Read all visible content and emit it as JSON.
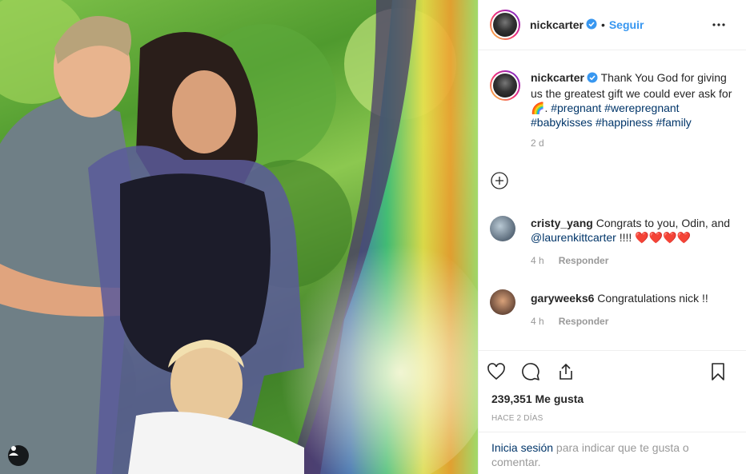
{
  "post": {
    "username": "nickcarter",
    "follow_label": "Seguir",
    "separator": "•"
  },
  "caption": {
    "username": "nickcarter",
    "text": "Thank You God for giving us the greatest gift we could ever ask for ",
    "emoji": "🌈",
    "after_emoji": ". ",
    "hashtags": [
      "#pregnant",
      "#werepregnant",
      "#babykisses",
      "#happiness",
      "#family"
    ],
    "time": "2 d"
  },
  "comments": [
    {
      "username": "cristy_yang",
      "text_before": "Congrats to you, Odin, and ",
      "mention": "@laurenkittcarter",
      "text_after": " !!!! ",
      "hearts": "❤️❤️❤️❤️",
      "time": "4 h",
      "reply_label": "Responder"
    },
    {
      "username": "garyweeks6",
      "text": "Congratulations nick !!",
      "time": "4 h",
      "reply_label": "Responder"
    }
  ],
  "actions": {
    "likes": "239,351 Me gusta",
    "posted_ago": "HACE 2 DÍAS"
  },
  "login": {
    "link": "Inicia sesión",
    "rest": " para indicar que te gusta o comentar."
  },
  "colors": {
    "link_blue": "#3897f0",
    "hashtag_navy": "#003569",
    "meta_gray": "#999999",
    "verified_blue": "#3897f0"
  },
  "icons": [
    "user-tag-icon",
    "verified-badge-icon",
    "more-options-icon",
    "add-comment-icon",
    "heart-icon",
    "comment-icon",
    "share-icon",
    "bookmark-icon"
  ]
}
